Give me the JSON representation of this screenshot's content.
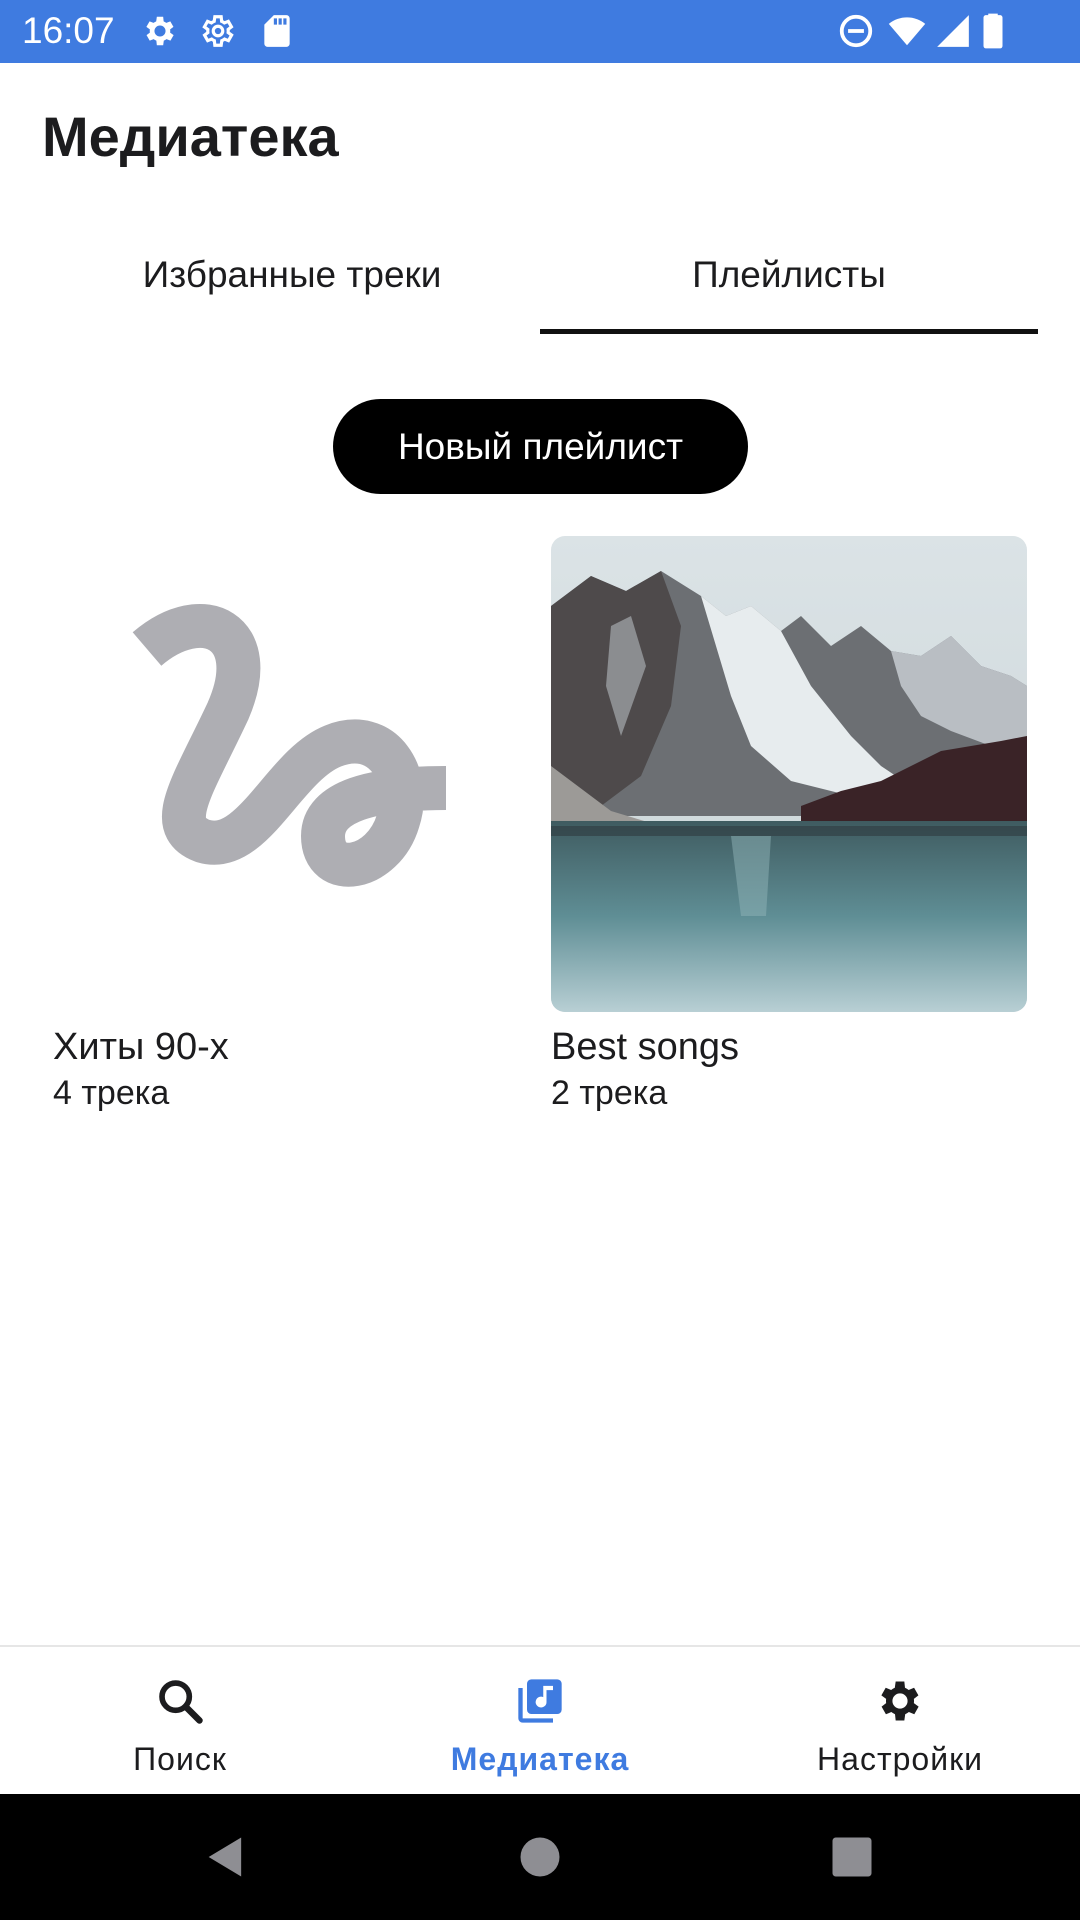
{
  "status_bar": {
    "time": "16:07",
    "icons": [
      "settings-icon",
      "settings-outline-icon",
      "sd-card-icon",
      "do-not-disturb-icon",
      "wifi-icon",
      "signal-icon",
      "battery-icon"
    ],
    "color": "#3f7be0"
  },
  "header": {
    "title": "Медиатека"
  },
  "tabs": [
    {
      "label": "Избранные треки",
      "selected": false
    },
    {
      "label": "Плейлисты",
      "selected": true
    }
  ],
  "new_playlist_button": {
    "label": "Новый плейлист"
  },
  "playlists": [
    {
      "title": "Хиты 90-х",
      "count": "4 трека",
      "cover": "squiggle-placeholder-icon"
    },
    {
      "title": "Best songs",
      "count": "2 трека",
      "cover": "mountain-lake-photo"
    }
  ],
  "bottom_nav": {
    "items": [
      {
        "label": "Поиск",
        "icon": "search-icon",
        "active": false
      },
      {
        "label": "Медиатека",
        "icon": "music-library-icon",
        "active": true
      },
      {
        "label": "Настройки",
        "icon": "gear-icon",
        "active": false
      }
    ],
    "active_color": "#3f7be0"
  },
  "system_nav": {
    "buttons": [
      "back-icon",
      "home-icon",
      "recents-icon"
    ]
  }
}
